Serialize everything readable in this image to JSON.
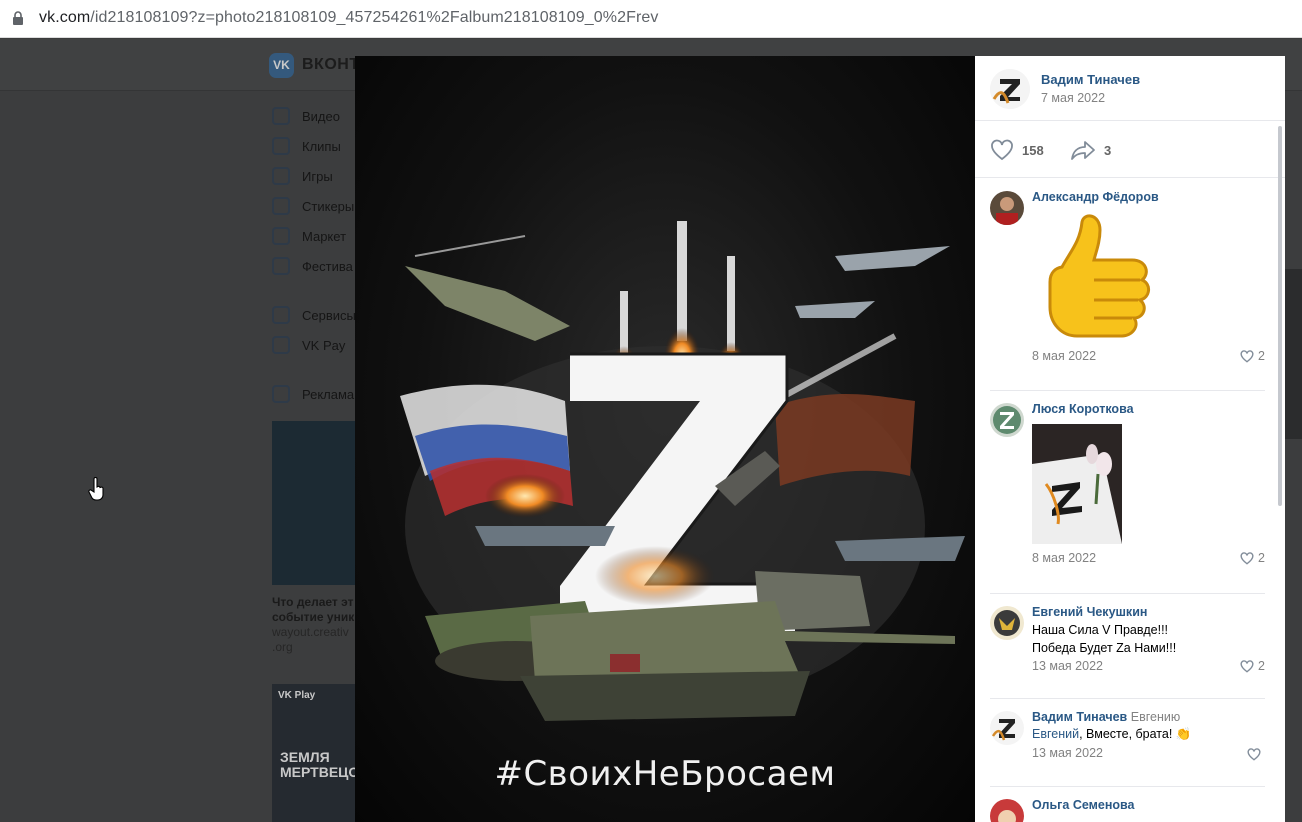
{
  "browser": {
    "url_domain": "vk.com",
    "url_path": "/id218108109?z=photo218108109_457254261%2Falbum218108109_0%2Frev"
  },
  "background": {
    "logo_text": "ВКОНТ",
    "nav": [
      {
        "label": "Видео",
        "icon": "video-icon"
      },
      {
        "label": "Клипы",
        "icon": "clips-icon"
      },
      {
        "label": "Игры",
        "icon": "games-icon"
      },
      {
        "label": "Стикеры",
        "icon": "stickers-icon"
      },
      {
        "label": "Маркет",
        "icon": "market-icon"
      },
      {
        "label": "Фестива",
        "icon": "festival-icon"
      },
      {
        "label": "Сервисы",
        "icon": "services-icon"
      },
      {
        "label": "VK Pay",
        "icon": "vkpay-icon"
      },
      {
        "label": "Реклама",
        "icon": "ads-icon"
      }
    ],
    "ad_title": "Что делает эт событие уник",
    "ad_domain": "wayout.creativ .org",
    "game_badge": "VK Play",
    "game_title": "ЗЕМЛЯ МЕРТВЕЦОВ"
  },
  "photo": {
    "caption": "#СвоихНеБросаем",
    "big_letter": "Z"
  },
  "owner": {
    "name": "Вадим Тиначев",
    "date": "7 мая 2022"
  },
  "actions": {
    "likes": "158",
    "shares": "3"
  },
  "comments": [
    {
      "name": "Александр Фёдоров",
      "date": "8 мая 2022",
      "likes": "2",
      "attachment": "thumbs-up-sticker"
    },
    {
      "name": "Люся Короткова",
      "date": "8 мая 2022",
      "likes": "2",
      "attachment": "photo"
    },
    {
      "name": "Евгений Чекушкин",
      "line1": "Наша Сила V Правде!!!",
      "line2": "Победа Будет Za Нами!!!",
      "date": "13 мая 2022",
      "likes": "2"
    },
    {
      "name": "Вадим Тиначев",
      "reply_to": "Евгению",
      "mention": "Евгений",
      "text": ", Вместе, брата! 👏",
      "date": "13 мая 2022",
      "likes": ""
    },
    {
      "name": "Ольга Семенова"
    }
  ],
  "colors": {
    "link": "#2a5885",
    "muted": "#828282"
  }
}
